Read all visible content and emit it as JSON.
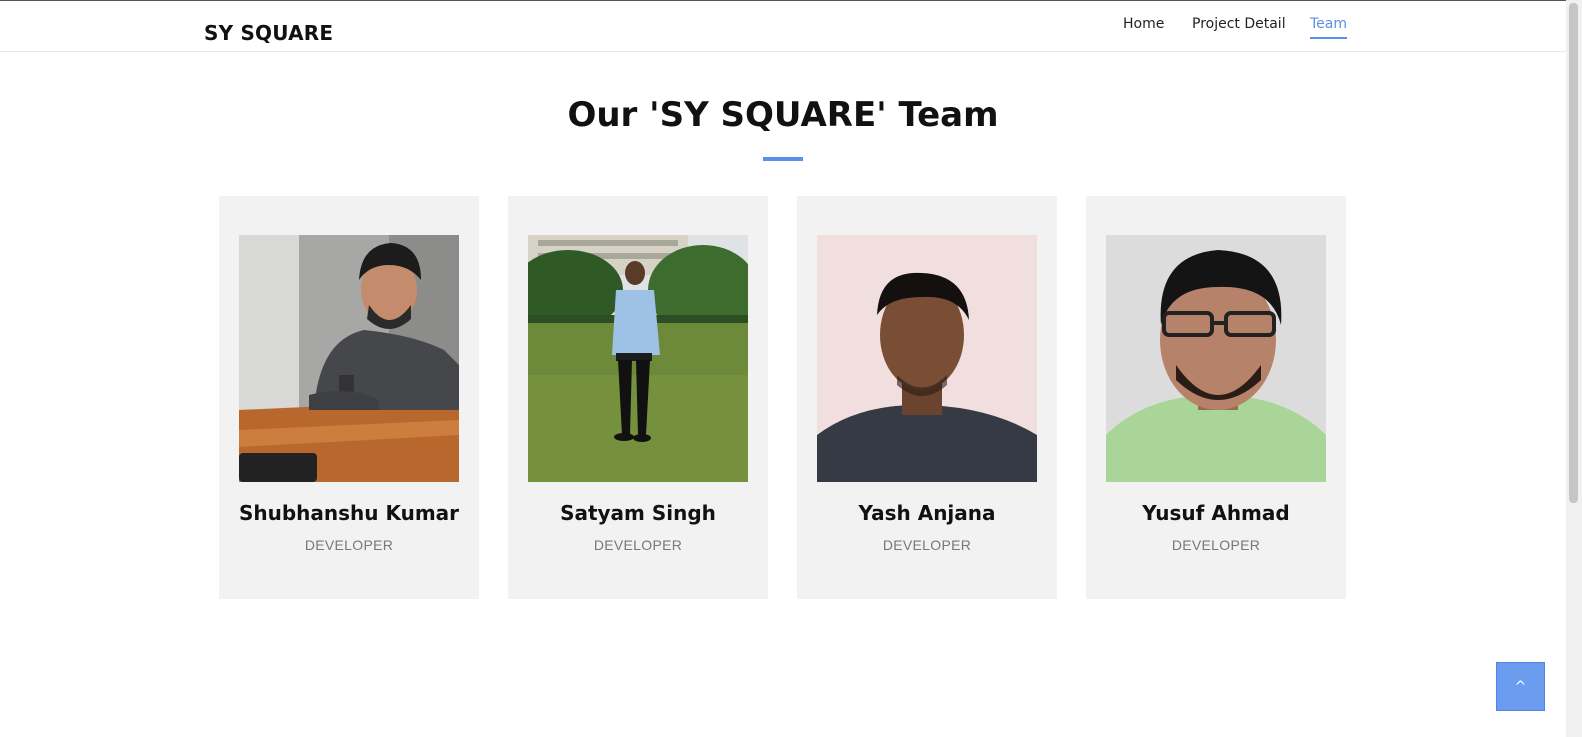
{
  "header": {
    "logo": "SY SQUARE",
    "nav": [
      {
        "label": "Home"
      },
      {
        "label": "Project Detail"
      },
      {
        "label": "Team",
        "active": true
      }
    ]
  },
  "section": {
    "title": "Our 'SY SQUARE' Team",
    "accent_color": "#5c8fe8"
  },
  "team": [
    {
      "name": "Shubhanshu Kumar",
      "role": "DEVELOPER",
      "photo": "photo of person seated at wooden table"
    },
    {
      "name": "Satyam Singh",
      "role": "DEVELOPER",
      "photo": "photo of person standing on lawn"
    },
    {
      "name": "Yash Anjana",
      "role": "DEVELOPER",
      "photo": "portrait photo against pink wall"
    },
    {
      "name": "Yusuf Ahmad",
      "role": "DEVELOPER",
      "photo": "portrait photo with glasses"
    }
  ],
  "back_to_top": {
    "icon": "chevron-up-icon",
    "glyph": "^"
  }
}
